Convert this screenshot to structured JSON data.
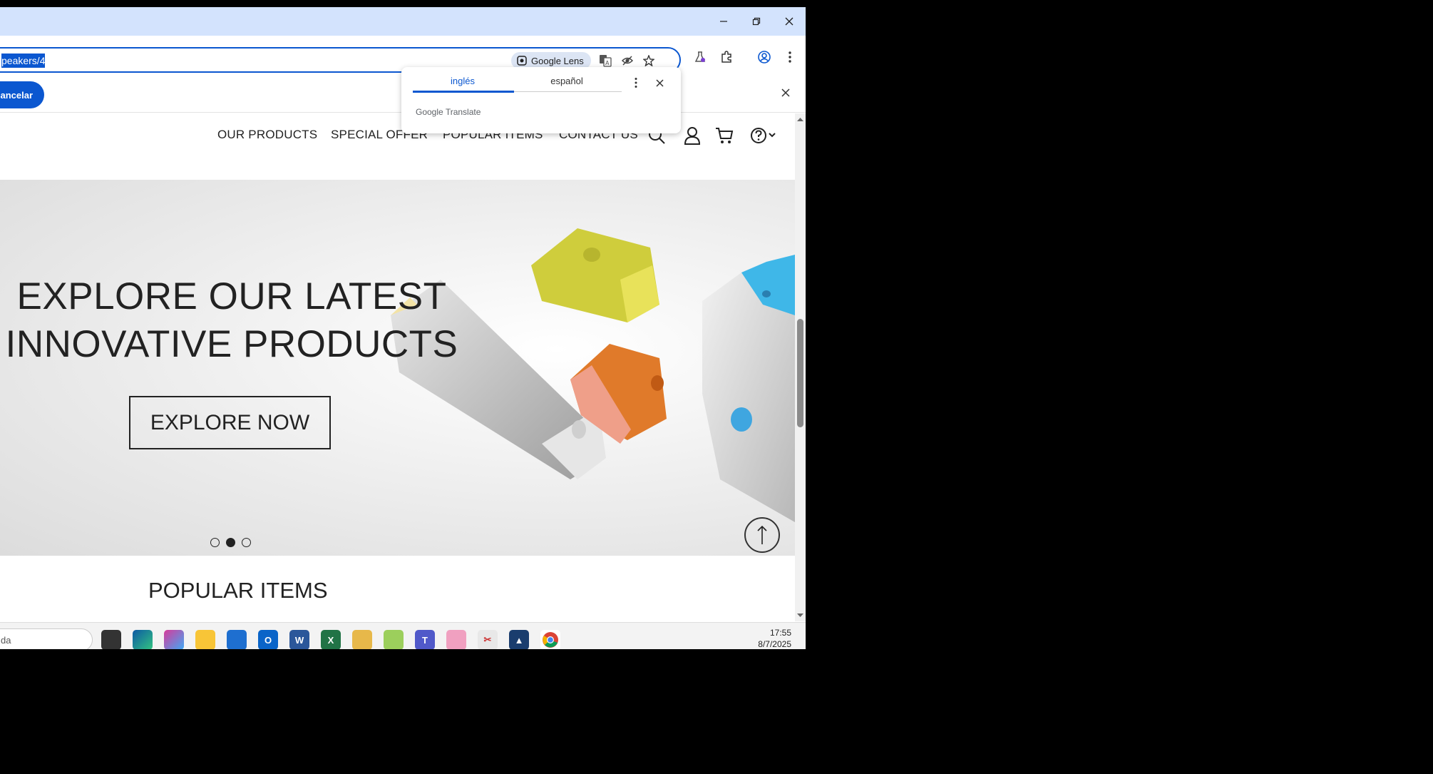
{
  "browser": {
    "address_text": "peakers/4",
    "lens_label": "Google Lens",
    "translate_cancel_label": "Cancelar"
  },
  "translate_popup": {
    "tabs": [
      "inglés",
      "español"
    ],
    "selected_tab": "inglés",
    "footer_brand": "Google",
    "footer_text": "Translate"
  },
  "site": {
    "nav": [
      "OUR PRODUCTS",
      "SPECIAL OFFER",
      "POPULAR ITEMS",
      "CONTACT US"
    ],
    "hero": {
      "title_line1": "EXPLORE OUR LATEST",
      "title_line2": "INNOVATIVE PRODUCTS",
      "cta": "EXPLORE NOW",
      "slides_total": 3,
      "active_slide": 2
    },
    "section_title": "POPULAR ITEMS"
  },
  "taskbar": {
    "search_text": "da",
    "time": "17:55",
    "date": "8/7/2025",
    "apps": [
      "file-explorer-icon",
      "edge-icon",
      "m365-copilot-icon",
      "folder-icon",
      "ms-store-icon",
      "outlook-icon",
      "word-icon",
      "excel-icon",
      "snip-app-icon",
      "image-app-icon",
      "teams-icon",
      "git-icon",
      "snipping-tool-icon",
      "drive-icon",
      "chrome-icon"
    ]
  },
  "colors": {
    "accent": "#0b57d0",
    "titlebar": "#d3e3fd",
    "speaker_yellow": "#c9c83a",
    "speaker_orange": "#e07a2a",
    "speaker_blue": "#3fb7e8"
  }
}
